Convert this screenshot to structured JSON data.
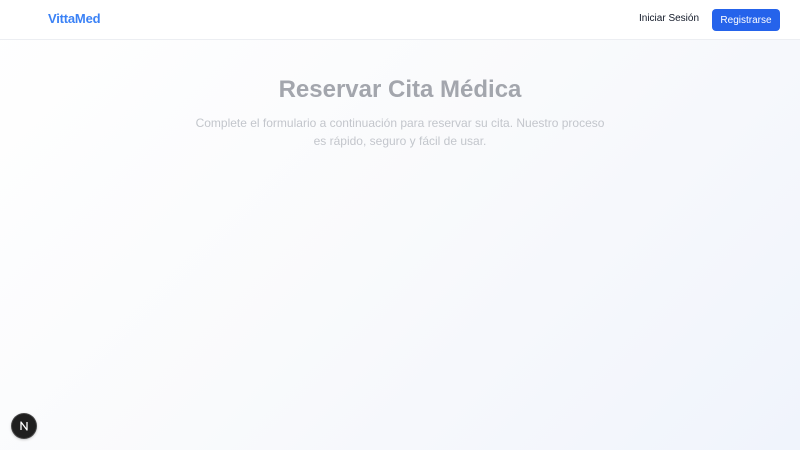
{
  "navbar": {
    "brand": "VittaMed",
    "login_label": "Iniciar Sesión",
    "register_label": "Registrarse"
  },
  "hero": {
    "title": "Reservar Cita Médica",
    "subtitle": "Complete el formulario a continuación para reservar su cita. Nuestro proceso es rápido, seguro y fácil de usar."
  },
  "dev_badge": {
    "icon": "next-logo-icon",
    "letter": "N"
  },
  "colors": {
    "brand": "#3b82f6",
    "primary_button": "#2563eb",
    "title": "#a3a6ad",
    "subtitle": "#c3c6cc"
  }
}
